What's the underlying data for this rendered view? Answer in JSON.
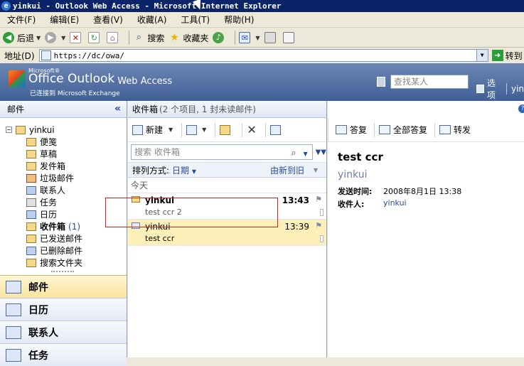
{
  "window": {
    "title": "yinkui - Outlook Web Access - Microsoft Internet Explorer"
  },
  "menu": [
    "文件(F)",
    "编辑(E)",
    "查看(V)",
    "收藏(A)",
    "工具(T)",
    "帮助(H)"
  ],
  "toolbar": {
    "back": "后退",
    "search": "搜索",
    "favorites": "收藏夹"
  },
  "address": {
    "label": "地址(D)",
    "url": "https://dc/owa/",
    "go": "转到"
  },
  "owa": {
    "brand_small": "Microsoft®",
    "brand_main": "Office Outlook",
    "brand_sub": "Web Access",
    "connected": "已连接到 Microsoft Exchange",
    "find_person_placeholder": "查找某人",
    "options": "选项",
    "user_fragment": "yin"
  },
  "left": {
    "header": "邮件",
    "root": "yinkui",
    "folders": [
      {
        "label": "便笺",
        "count": ""
      },
      {
        "label": "草稿",
        "count": ""
      },
      {
        "label": "发件箱",
        "count": ""
      },
      {
        "label": "垃圾邮件",
        "count": ""
      },
      {
        "label": "联系人",
        "count": ""
      },
      {
        "label": "任务",
        "count": ""
      },
      {
        "label": "日历",
        "count": ""
      },
      {
        "label": "收件箱",
        "count": "(1)"
      },
      {
        "label": "已发送邮件",
        "count": ""
      },
      {
        "label": "已删除邮件",
        "count": ""
      },
      {
        "label": "搜索文件夹",
        "count": ""
      }
    ],
    "nav": [
      "邮件",
      "日历",
      "联系人",
      "任务"
    ]
  },
  "mid": {
    "title": "收件箱",
    "count": "(2 个项目, 1 封未读邮件)",
    "new_label": "新建",
    "search_placeholder": "搜索 收件箱",
    "sort_label": "排列方式:",
    "sort_by": "日期",
    "sort_order": "由新到旧",
    "group": "今天",
    "messages": [
      {
        "from": "yinkui",
        "time": "13:43",
        "subject": "test ccr 2",
        "unread": true
      },
      {
        "from": "yinkui",
        "time": "13:39",
        "subject": "test ccr",
        "unread": false
      }
    ]
  },
  "reading": {
    "reply": "答复",
    "reply_all": "全部答复",
    "forward": "转发",
    "subject": "test ccr",
    "from": "yinkui",
    "sent_label": "发送时间:",
    "sent_value": "2008年8月1日 13:38",
    "to_label": "收件人:",
    "to_value": "yinkui"
  },
  "colors": {
    "owa_header": "#3f5f95",
    "selected_row": "#fdf0b8",
    "accent": "#254b96"
  }
}
